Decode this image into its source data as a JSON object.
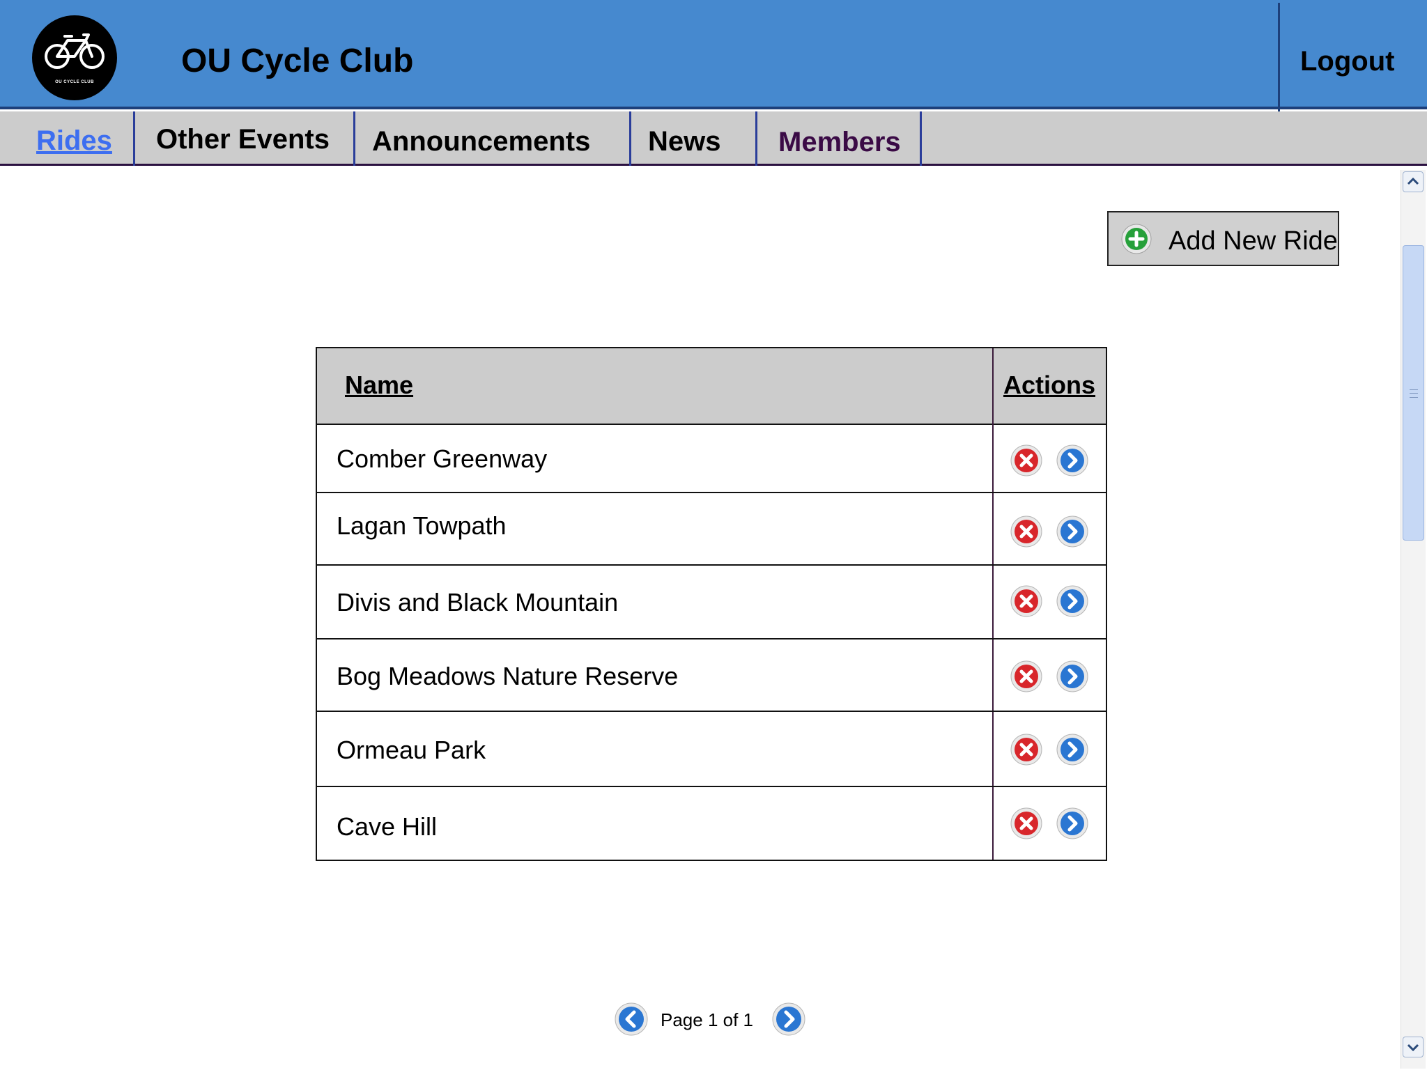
{
  "header": {
    "logo_text": "OU CYCLE CLUB",
    "title": "OU Cycle Club",
    "logout_label": "Logout"
  },
  "nav": {
    "tabs": [
      {
        "label": "Rides",
        "active": true
      },
      {
        "label": "Other Events"
      },
      {
        "label": "Announcements"
      },
      {
        "label": "News"
      },
      {
        "label": "Members"
      }
    ]
  },
  "toolbar": {
    "add_label": "Add New Ride",
    "add_icon": "plus-circle-icon"
  },
  "table": {
    "columns": [
      "Name",
      "Actions"
    ],
    "rows": [
      {
        "name": "Comber Greenway"
      },
      {
        "name": "Lagan Towpath"
      },
      {
        "name": "Divis and Black Mountain"
      },
      {
        "name": "Bog Meadows Nature Reserve"
      },
      {
        "name": "Ormeau Park"
      },
      {
        "name": "Cave Hill"
      }
    ],
    "row_actions": [
      "delete-icon",
      "open-icon"
    ]
  },
  "pager": {
    "text": "Page 1 of 1"
  },
  "colors": {
    "header_bg": "#4689cf",
    "nav_bg": "#cccccc",
    "active_tab": "#3d6ef0",
    "delete": "#d8262b",
    "open": "#2a76d2"
  }
}
